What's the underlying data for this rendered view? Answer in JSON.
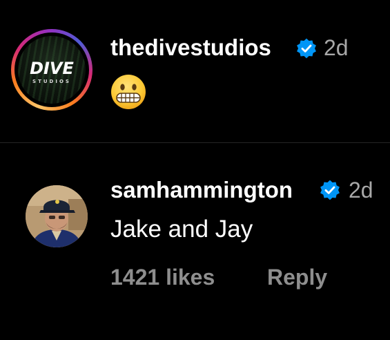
{
  "comments": [
    {
      "username": "thedivestudios",
      "verified": true,
      "time": "2d",
      "emoji": "grimacing-face",
      "avatar": {
        "logo_text": "DIVE",
        "logo_subtext": "STUDIOS",
        "has_story_ring": true
      }
    },
    {
      "username": "samhammington",
      "verified": true,
      "time": "2d",
      "text": "Jake and Jay",
      "likes": "1421 likes",
      "reply_label": "Reply"
    }
  ],
  "colors": {
    "background": "#000000",
    "username": "#ffffff",
    "timestamp": "#a8a8a8",
    "meta": "#8e8e8e",
    "verified_badge": "#0095f6",
    "divider": "#262626"
  }
}
